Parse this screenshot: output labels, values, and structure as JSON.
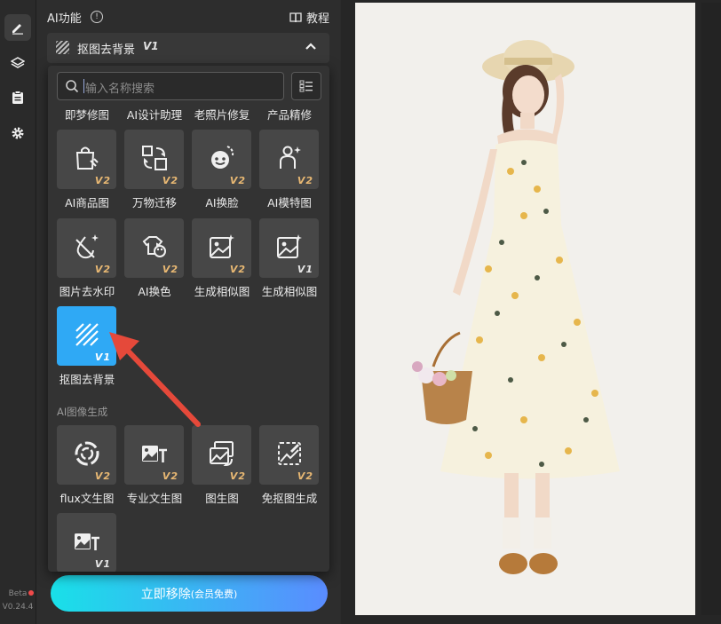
{
  "rail": {
    "tools": [
      "edit-tool",
      "layers-tool",
      "history-tool",
      "settings-tool"
    ],
    "beta_label": "Beta",
    "version": "V0.24.4"
  },
  "panel": {
    "title": "AI功能",
    "info": "!",
    "tutorial": "教程",
    "section": {
      "title": "抠图去背景",
      "version": "V1"
    }
  },
  "dropdown": {
    "search_placeholder": "输入名称搜索",
    "top_row": [
      "即梦修图",
      "AI设计助理",
      "老照片修复",
      "产品精修"
    ],
    "tools": [
      {
        "label": "AI商品图",
        "version": "V2",
        "icon": "shopping-bag-icon"
      },
      {
        "label": "万物迁移",
        "version": "V2",
        "icon": "transfer-icon"
      },
      {
        "label": "AI换脸",
        "version": "V2",
        "icon": "face-swap-icon"
      },
      {
        "label": "AI模特图",
        "version": "V2",
        "icon": "model-icon"
      },
      {
        "label": "图片去水印",
        "version": "V2",
        "icon": "remove-watermark-icon"
      },
      {
        "label": "AI换色",
        "version": "V2",
        "icon": "recolor-icon"
      },
      {
        "label": "生成相似图",
        "version": "V2",
        "icon": "similar-image-icon"
      },
      {
        "label": "生成相似图",
        "version": "V1",
        "icon": "similar-image-icon"
      },
      {
        "label": "抠图去背景",
        "version": "V1",
        "icon": "remove-background-icon"
      }
    ],
    "category_gen": "AI图像生成",
    "gen_tools": [
      {
        "label": "flux文生图",
        "version": "V2",
        "icon": "flux-icon"
      },
      {
        "label": "专业文生图",
        "version": "V2",
        "icon": "text-to-image-icon"
      },
      {
        "label": "图生图",
        "version": "V2",
        "icon": "image-to-image-icon"
      },
      {
        "label": "免抠图生成",
        "version": "V2",
        "icon": "no-cutout-icon"
      },
      {
        "label": "",
        "version": "V1",
        "icon": "text-to-image-icon"
      }
    ]
  },
  "cta": {
    "label": "立即移除",
    "sub": "(会员免费)"
  },
  "colors": {
    "accent": "#2fa9f5",
    "version_gold": "#e8b873",
    "arrow": "#e5493a"
  }
}
